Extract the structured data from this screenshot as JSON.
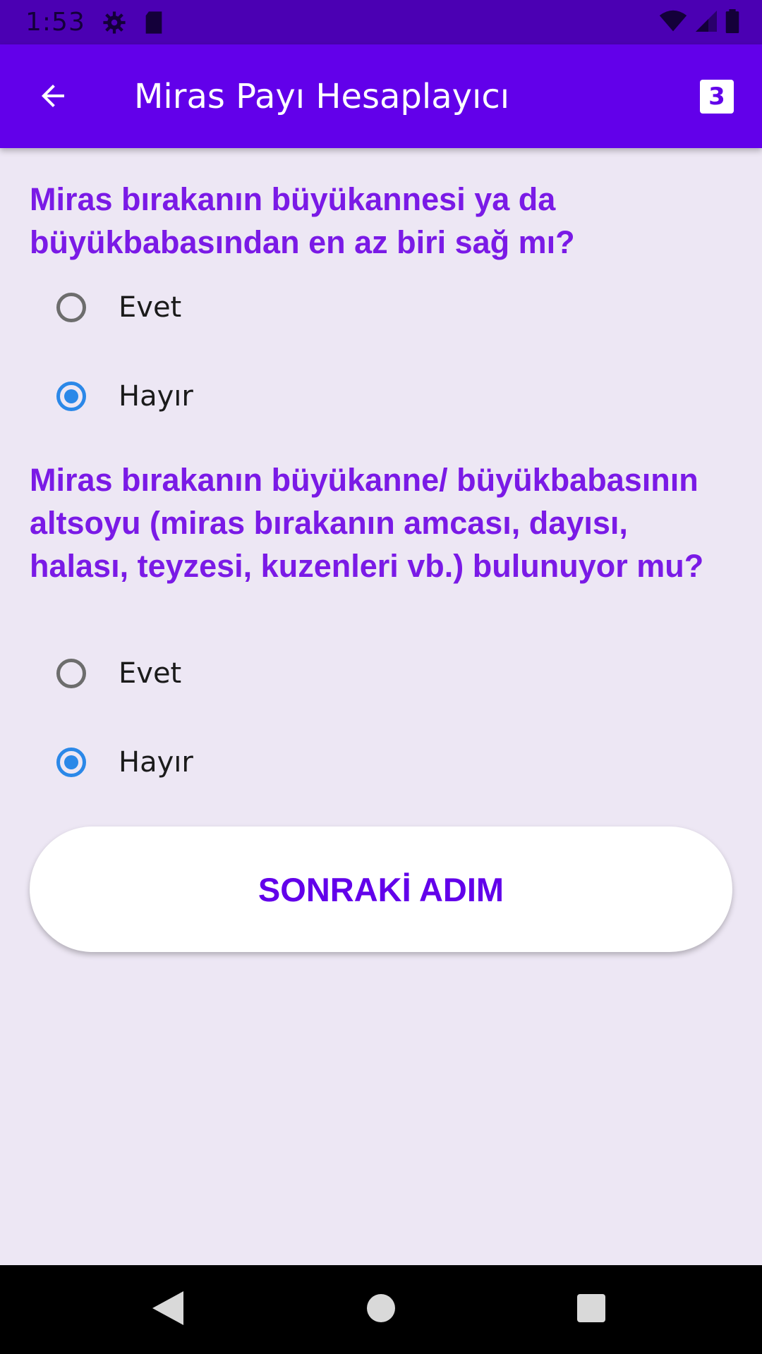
{
  "status_bar": {
    "time": "1:53"
  },
  "app_bar": {
    "title": "Miras Payı Hesaplayıcı",
    "step_badge": "3"
  },
  "questions": [
    {
      "text": "Miras bırakanın büyükannesi ya da büyükbabasından en az biri sağ mı?",
      "options": [
        {
          "label": "Evet",
          "selected": false
        },
        {
          "label": "Hayır",
          "selected": true
        }
      ]
    },
    {
      "text": "Miras bırakanın büyükanne/ büyükbabasının altsoyu (miras bırakanın amcası, dayısı, halası, teyzesi, kuzenleri vb.) bulunuyor mu?",
      "options": [
        {
          "label": "Evet",
          "selected": false
        },
        {
          "label": "Hayır",
          "selected": true
        }
      ]
    }
  ],
  "next_button": {
    "label": "SONRAKİ ADIM"
  },
  "colors": {
    "primary": "#6200ea",
    "question_text": "#7a1ae6",
    "radio_selected": "#2b88e8",
    "background": "#ede7f4"
  }
}
